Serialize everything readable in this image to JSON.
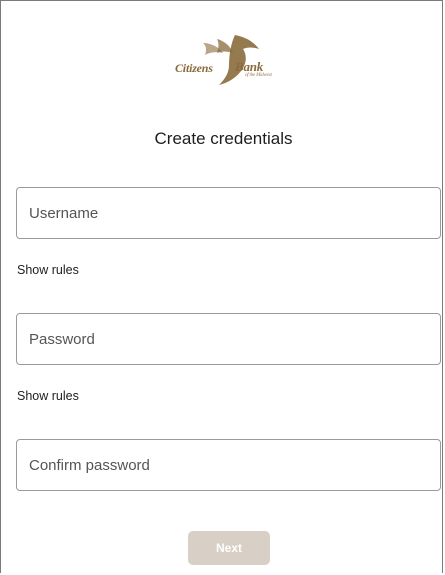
{
  "logo": {
    "word1": "Citizens",
    "word2": "Bank",
    "tagline": "of the Midwest"
  },
  "title": "Create credentials",
  "fields": {
    "username_placeholder": "Username",
    "password_placeholder": "Password",
    "confirm_placeholder": "Confirm password"
  },
  "rules": {
    "username_rules": "Show rules",
    "password_rules": "Show rules"
  },
  "buttons": {
    "next": "Next"
  },
  "colors": {
    "brand": "#8a6a3c",
    "button_disabled": "#d8d0c6",
    "border": "#9a9a9a"
  }
}
